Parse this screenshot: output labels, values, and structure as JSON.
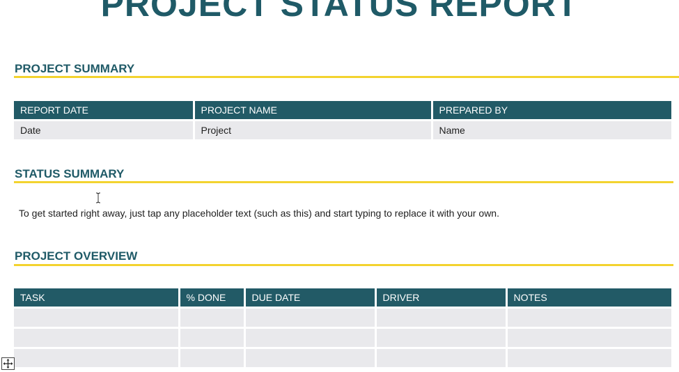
{
  "document": {
    "title": "PROJECT STATUS REPORT"
  },
  "project_summary": {
    "heading": "PROJECT SUMMARY",
    "table": {
      "headers": [
        "REPORT DATE",
        "PROJECT NAME",
        "PREPARED BY"
      ],
      "rows": [
        [
          "Date",
          "Project",
          "Name"
        ]
      ]
    }
  },
  "status_summary": {
    "heading": "STATUS SUMMARY",
    "body": "To get started right away, just tap any placeholder text (such as this) and start typing to replace it with your own."
  },
  "project_overview": {
    "heading": "PROJECT OVERVIEW",
    "table": {
      "headers": [
        "TASK",
        "% DONE",
        "DUE DATE",
        "DRIVER",
        "NOTES"
      ],
      "rows": [
        [
          "",
          "",
          "",
          "",
          ""
        ],
        [
          "",
          "",
          "",
          "",
          ""
        ],
        [
          "",
          "",
          "",
          "",
          ""
        ]
      ]
    }
  },
  "icons": {
    "text_cursor": "i-beam-cursor-icon",
    "table_move_handle": "move-arrows-icon"
  },
  "colors": {
    "title": "#1f5a67",
    "header_fill": "#225a66",
    "rule": "#f3d32f",
    "cell_fill": "#e9e9ec"
  }
}
